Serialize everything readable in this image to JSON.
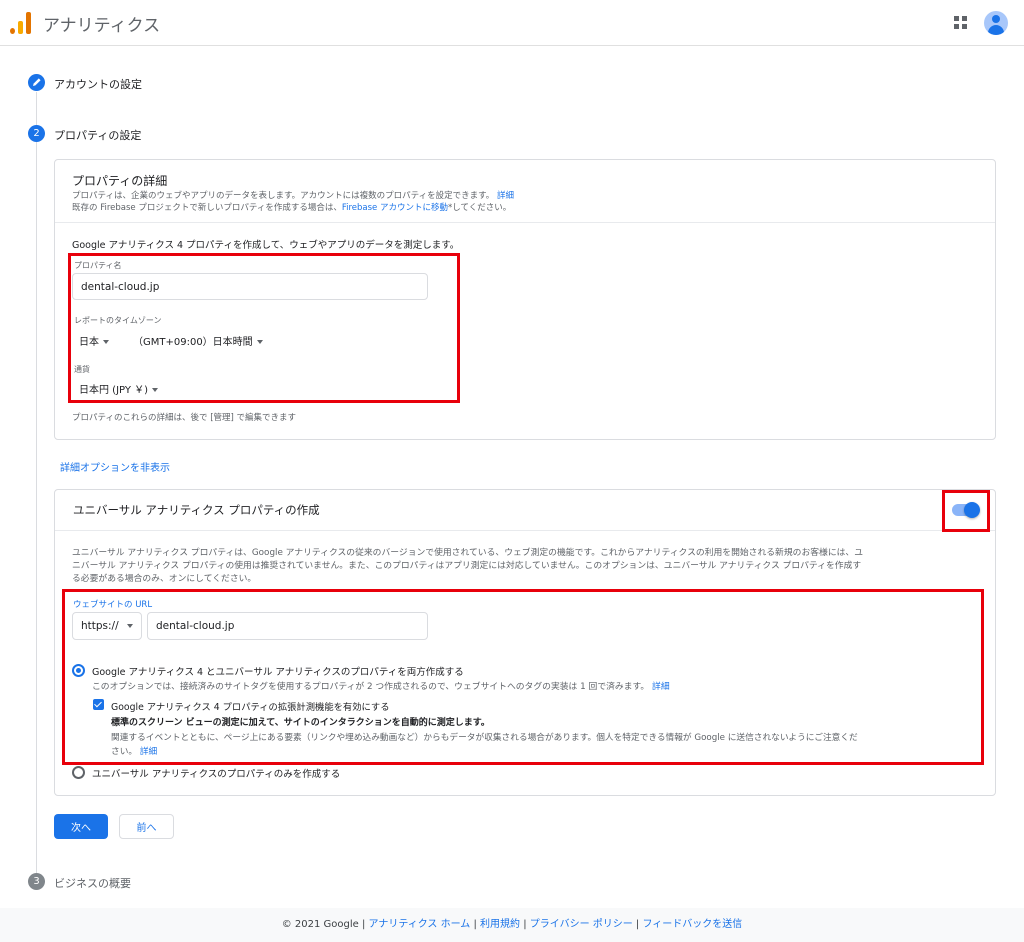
{
  "header": {
    "app_title": "アナリティクス"
  },
  "steps": [
    {
      "label": "アカウントの設定"
    },
    {
      "number": "2",
      "label": "プロパティの設定"
    },
    {
      "number": "3",
      "label": "ビジネスの概要"
    }
  ],
  "property_details": {
    "title": "プロパティの詳細",
    "desc1": "プロパティは、企業のウェブやアプリのデータを表します。アカウントには複数のプロパティを設定できます。",
    "desc1_link": "詳細",
    "desc2_pre": "既存の Firebase プロジェクトで新しいプロパティを作成する場合は、",
    "desc2_link": "Firebase アカウントに移動",
    "desc2_post": "*してください。",
    "intro": "Google アナリティクス 4 プロパティを作成して、ウェブやアプリのデータを測定します。",
    "name_label": "プロパティ名",
    "name_value": "dental-cloud.jp",
    "tz_label": "レポートのタイムゾーン",
    "tz_country": "日本",
    "tz_value": "（GMT+09:00）日本時間",
    "currency_label": "通貨",
    "currency_value": "日本円 (JPY ￥)",
    "note": "プロパティのこれらの詳細は、後で [管理] で編集できます"
  },
  "advanced_link": "詳細オプションを非表示",
  "universal": {
    "title": "ユニバーサル アナリティクス プロパティの作成",
    "toggle_on": true,
    "desc_line1": "ユニバーサル アナリティクス プロパティは、Google アナリティクスの従来のバージョンで使用されている、ウェブ測定の機能です。これからアナリティクスの利用を開始される新規のお客様には、ユ",
    "desc_line2": "ニバーサル アナリティクス プロパティの使用は推奨されていません。また、このプロパティはアプリ測定には対応していません。このオプションは、ユニバーサル アナリティクス プロパティを作成す",
    "desc_line3": "る必要がある場合のみ、オンにしてください。",
    "url_label": "ウェブサイトの URL",
    "protocol": "https://",
    "url_value": "dental-cloud.jp",
    "option1_label": "Google アナリティクス 4 とユニバーサル アナリティクスのプロパティを両方作成する",
    "option1_desc": "このオプションでは、接続済みのサイトタグを使用するプロパティが 2 つ作成されるので、ウェブサイトへのタグの実装は 1 回で済みます。",
    "option1_link": "詳細",
    "enhanced_label": "Google アナリティクス 4 プロパティの拡張計測機能を有効にする",
    "enhanced_bold": "標準のスクリーン ビューの測定に加えて、サイトのインタラクションを自動的に測定します。",
    "enhanced_desc1": "関連するイベントとともに、ページ上にある要素（リンクや埋め込み動画など）からもデータが収集される場合があります。個人を特定できる情報が Google に送信されないようにご注意くだ",
    "enhanced_desc2": "さい。",
    "enhanced_link": "詳細",
    "option2_label": "ユニバーサル アナリティクスのプロパティのみを作成する"
  },
  "buttons": {
    "next": "次へ",
    "back": "前へ"
  },
  "footer": {
    "copyright": "© 2021 Google",
    "links": [
      "アナリティクス ホーム",
      "利用規約",
      "プライバシー ポリシー",
      "フィードバックを送信"
    ]
  },
  "colors": {
    "accent": "#1a73e8",
    "highlight": "#e8000b"
  }
}
